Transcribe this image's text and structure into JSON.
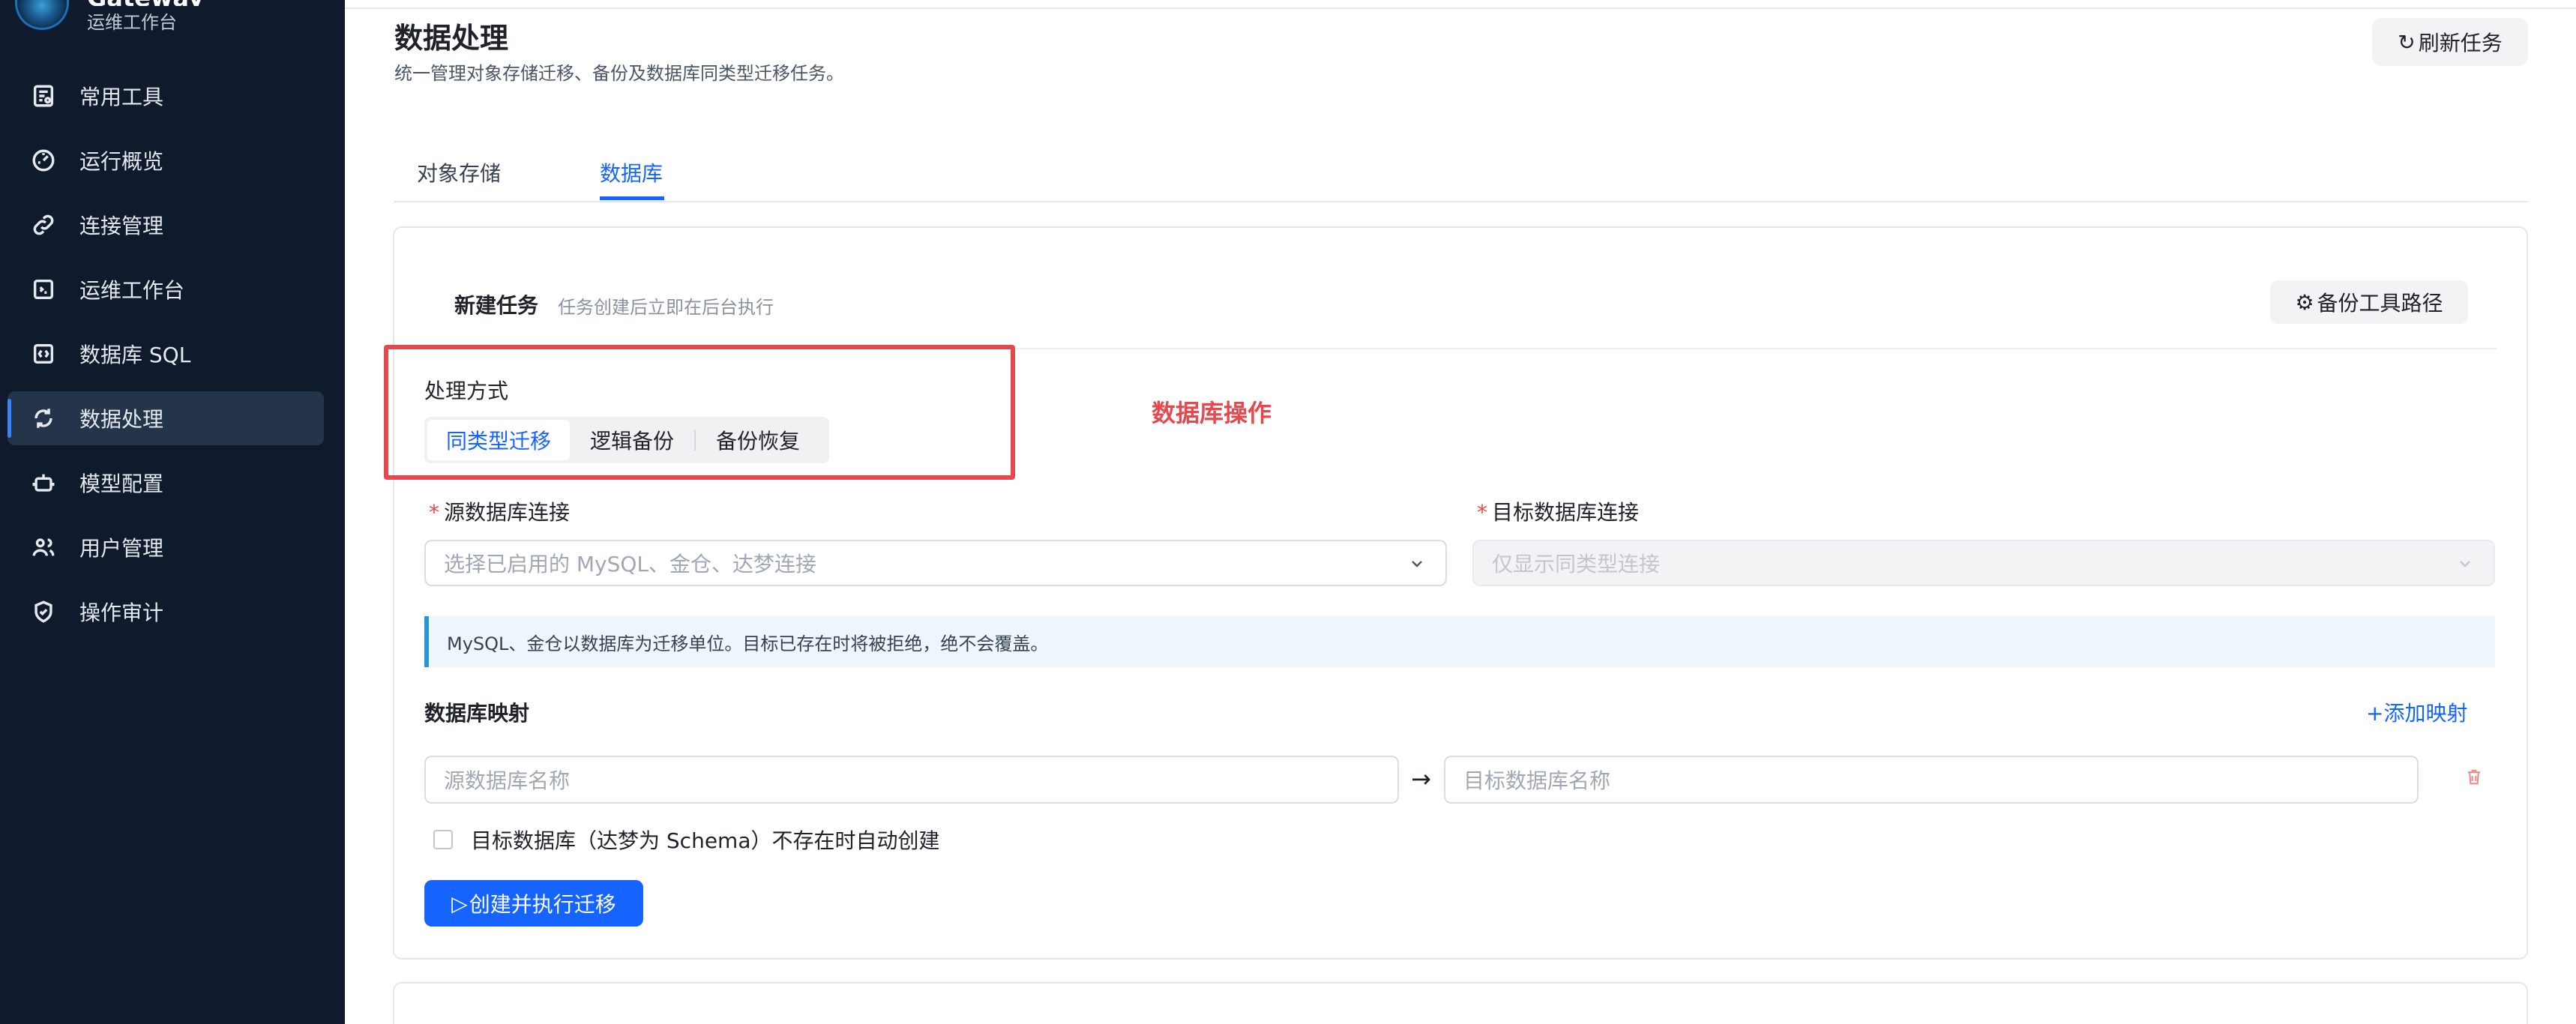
{
  "brand": {
    "name": "Gateway",
    "subtitle": "运维工作台"
  },
  "sidebar": {
    "items": [
      {
        "label": "常用工具",
        "icon": "tools-icon"
      },
      {
        "label": "运行概览",
        "icon": "dashboard-icon"
      },
      {
        "label": "连接管理",
        "icon": "link-icon"
      },
      {
        "label": "运维工作台",
        "icon": "terminal-icon"
      },
      {
        "label": "数据库 SQL",
        "icon": "sql-icon"
      },
      {
        "label": "数据处理",
        "icon": "sync-icon",
        "active": true
      },
      {
        "label": "模型配置",
        "icon": "robot-icon"
      },
      {
        "label": "用户管理",
        "icon": "users-icon"
      },
      {
        "label": "操作审计",
        "icon": "shield-icon"
      }
    ]
  },
  "header": {
    "title": "数据处理",
    "subtitle": "统一管理对象存储迁移、备份及数据库同类型迁移任务。",
    "refresh_label": "刷新任务"
  },
  "tabs": [
    {
      "label": "对象存储",
      "active": false
    },
    {
      "label": "数据库",
      "active": true
    }
  ],
  "task_card": {
    "title": "新建任务",
    "subtitle": "任务创建后立即在后台执行",
    "tool_path_label": "备份工具路径",
    "mode_label": "处理方式",
    "modes": [
      {
        "label": "同类型迁移",
        "active": true
      },
      {
        "label": "逻辑备份",
        "active": false
      },
      {
        "label": "备份恢复",
        "active": false
      }
    ],
    "annotation": "数据库操作",
    "source_label": "源数据库连接",
    "source_placeholder": "选择已启用的 MySQL、金仓、达梦连接",
    "target_label": "目标数据库连接",
    "target_placeholder": "仅显示同类型连接",
    "notice": "MySQL、金仓以数据库为迁移单位。目标已存在时将被拒绝，绝不会覆盖。",
    "mapping_label": "数据库映射",
    "add_mapping_label": "添加映射",
    "mapping_source_placeholder": "源数据库名称",
    "mapping_target_placeholder": "目标数据库名称",
    "auto_create_label": "目标数据库（达梦为 Schema）不存在时自动创建",
    "submit_label": "创建并执行迁移"
  },
  "colors": {
    "accent": "#1664ff",
    "sidebar_bg": "#0f1b2d",
    "annotation": "#e5484d"
  }
}
